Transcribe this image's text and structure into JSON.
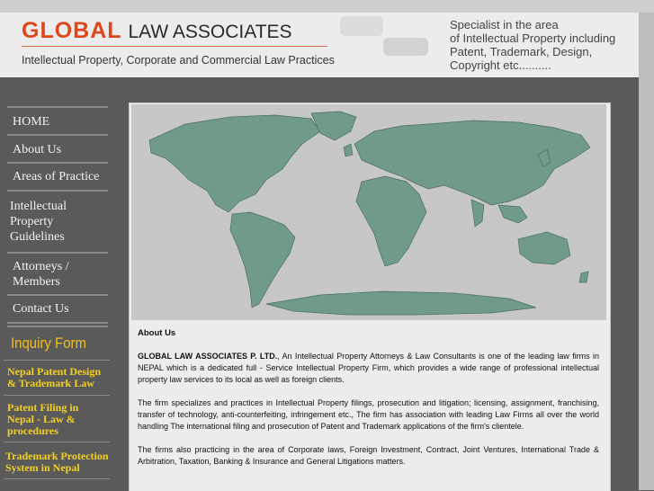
{
  "header": {
    "logo_red": "GLOBAL",
    "logo_dark": "LAW ASSOCIATES",
    "tagline": "Intellectual Property, Corporate and Commercial Law Practices",
    "spec_lines": [
      "Specialist in the area",
      "of Intellectual Property including",
      "Patent, Trademark, Design,",
      "Copyright etc.........."
    ]
  },
  "nav": {
    "home": "HOME",
    "about": "About Us",
    "areas": "Areas of Practice",
    "ip1": "Intellectual",
    "ip2": "Property",
    "ip3": "Guidelines",
    "att1": "Attorneys /",
    "att2": "Members",
    "contact": "Contact Us"
  },
  "inquiry": "Inquiry Form",
  "links": {
    "l1a": "Nepal Patent Design",
    "l1b": "& Trademark Law",
    "l2a": "Patent Filing in",
    "l2b": "Nepal - Law &",
    "l2c": "procedures",
    "l3a": "Trademark Protection",
    "l3b": "System in Nepal"
  },
  "content": {
    "heading": "About Us",
    "p1_bold": "GLOBAL LAW ASSOCIATES P. LTD.",
    "p1_rest": ", An Intellectual Property Attorneys & Law Consultants is one of the leading law firms in NEPAL which is a dedicated full - Service Intellectual Property Firm, which provides a wide range of professional intellectual property law services to its local as well as foreign clients.",
    "p2": "The firm specializes and practices in Intellectual Property filings, prosecution and litigation; licensing, assignment, franchising, transfer of technology, anti-counterfeiting, infringement etc., The firm has association with leading Law Firms all over the world handling The international filing and prosecution of Patent and Trademark applications of the firm's clientele.",
    "p3": "The firms also practicing in the area of Corporate laws, Foreign Investment, Contract, Joint Ventures, International Trade & Arbitration, Taxation, Banking & Insurance and General Litigations matters."
  },
  "colors": {
    "accent": "#e0461c",
    "link": "#f4d020",
    "map_land": "#6f9b88"
  },
  "map_icon": "world-map"
}
